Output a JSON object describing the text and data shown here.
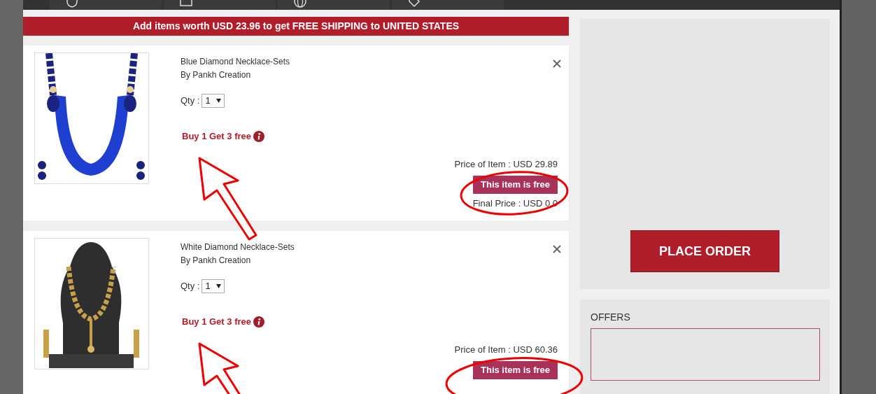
{
  "banner": "Add items worth USD 23.96 to get FREE SHIPPING to UNITED STATES",
  "nav_tiles": [
    {
      "kind": "shield"
    },
    {
      "kind": "box"
    },
    {
      "kind": "globe"
    },
    {
      "kind": "tag"
    }
  ],
  "items": [
    {
      "kind": "blue",
      "title": "Blue Diamond Necklace-Sets",
      "seller": "By Pankh Creation",
      "qty_label": "Qty :",
      "qty": "1",
      "offer": "Buy 1 Get 3 free",
      "price": "Price of Item : USD 29.89",
      "badge": "This item is free",
      "final_price": "Final Price : USD 0.0"
    },
    {
      "kind": "gold",
      "title": "White Diamond Necklace-Sets",
      "seller": "By Pankh Creation",
      "qty_label": "Qty :",
      "qty": "1",
      "offer": "Buy 1 Get 3 free",
      "price": "Price of Item : USD 60.36",
      "badge": "This item is free"
    }
  ],
  "place_order": "PLACE ORDER",
  "offers": {
    "title": "OFFERS"
  }
}
